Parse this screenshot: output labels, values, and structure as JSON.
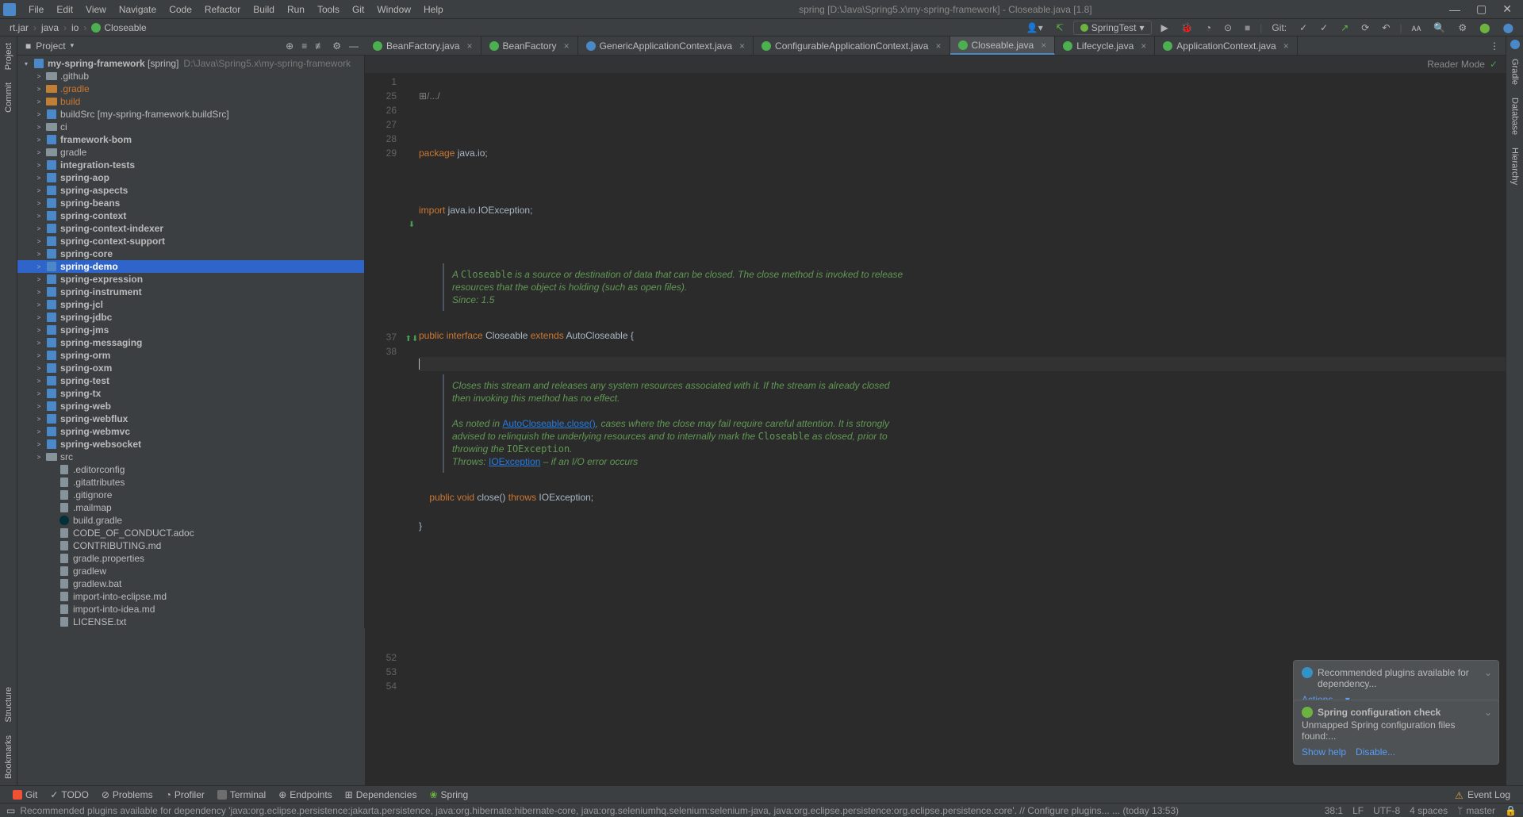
{
  "titlebar": {
    "menus": [
      "File",
      "Edit",
      "View",
      "Navigate",
      "Code",
      "Refactor",
      "Build",
      "Run",
      "Tools",
      "Git",
      "Window",
      "Help"
    ],
    "title": "spring [D:\\Java\\Spring5.x\\my-spring-framework] - Closeable.java [1.8]"
  },
  "navbar": {
    "crumbs": [
      "rt.jar",
      "java",
      "io",
      "Closeable"
    ],
    "run_config": "SpringTest",
    "git_label": "Git:"
  },
  "project_panel_label": "Project",
  "tree": {
    "root": {
      "label": "my-spring-framework",
      "suffix": "[spring]",
      "path": "D:\\Java\\Spring5.x\\my-spring-framework"
    },
    "items": [
      {
        "label": ".github",
        "indent": 1,
        "ico": "folder",
        "arrow": ">"
      },
      {
        "label": ".gradle",
        "indent": 1,
        "ico": "folder-orange",
        "arrow": ">",
        "color": "orange"
      },
      {
        "label": "build",
        "indent": 1,
        "ico": "folder-orange",
        "arrow": ">",
        "color": "orange"
      },
      {
        "label": "buildSrc",
        "indent": 1,
        "ico": "mod",
        "arrow": ">",
        "suffix": "[my-spring-framework.buildSrc]"
      },
      {
        "label": "ci",
        "indent": 1,
        "ico": "folder",
        "arrow": ">"
      },
      {
        "label": "framework-bom",
        "indent": 1,
        "ico": "mod",
        "arrow": ">",
        "bold": true
      },
      {
        "label": "gradle",
        "indent": 1,
        "ico": "folder",
        "arrow": ">"
      },
      {
        "label": "integration-tests",
        "indent": 1,
        "ico": "mod",
        "arrow": ">",
        "bold": true
      },
      {
        "label": "spring-aop",
        "indent": 1,
        "ico": "mod",
        "arrow": ">",
        "bold": true
      },
      {
        "label": "spring-aspects",
        "indent": 1,
        "ico": "mod",
        "arrow": ">",
        "bold": true
      },
      {
        "label": "spring-beans",
        "indent": 1,
        "ico": "mod",
        "arrow": ">",
        "bold": true
      },
      {
        "label": "spring-context",
        "indent": 1,
        "ico": "mod",
        "arrow": ">",
        "bold": true
      },
      {
        "label": "spring-context-indexer",
        "indent": 1,
        "ico": "mod",
        "arrow": ">",
        "bold": true
      },
      {
        "label": "spring-context-support",
        "indent": 1,
        "ico": "mod",
        "arrow": ">",
        "bold": true
      },
      {
        "label": "spring-core",
        "indent": 1,
        "ico": "mod",
        "arrow": ">",
        "bold": true
      },
      {
        "label": "spring-demo",
        "indent": 1,
        "ico": "mod",
        "arrow": ">",
        "bold": true,
        "selected": true
      },
      {
        "label": "spring-expression",
        "indent": 1,
        "ico": "mod",
        "arrow": ">",
        "bold": true
      },
      {
        "label": "spring-instrument",
        "indent": 1,
        "ico": "mod",
        "arrow": ">",
        "bold": true
      },
      {
        "label": "spring-jcl",
        "indent": 1,
        "ico": "mod",
        "arrow": ">",
        "bold": true
      },
      {
        "label": "spring-jdbc",
        "indent": 1,
        "ico": "mod",
        "arrow": ">",
        "bold": true
      },
      {
        "label": "spring-jms",
        "indent": 1,
        "ico": "mod",
        "arrow": ">",
        "bold": true
      },
      {
        "label": "spring-messaging",
        "indent": 1,
        "ico": "mod",
        "arrow": ">",
        "bold": true
      },
      {
        "label": "spring-orm",
        "indent": 1,
        "ico": "mod",
        "arrow": ">",
        "bold": true
      },
      {
        "label": "spring-oxm",
        "indent": 1,
        "ico": "mod",
        "arrow": ">",
        "bold": true
      },
      {
        "label": "spring-test",
        "indent": 1,
        "ico": "mod",
        "arrow": ">",
        "bold": true
      },
      {
        "label": "spring-tx",
        "indent": 1,
        "ico": "mod",
        "arrow": ">",
        "bold": true
      },
      {
        "label": "spring-web",
        "indent": 1,
        "ico": "mod",
        "arrow": ">",
        "bold": true
      },
      {
        "label": "spring-webflux",
        "indent": 1,
        "ico": "mod",
        "arrow": ">",
        "bold": true
      },
      {
        "label": "spring-webmvc",
        "indent": 1,
        "ico": "mod",
        "arrow": ">",
        "bold": true
      },
      {
        "label": "spring-websocket",
        "indent": 1,
        "ico": "mod",
        "arrow": ">",
        "bold": true
      },
      {
        "label": "src",
        "indent": 1,
        "ico": "folder",
        "arrow": ">"
      },
      {
        "label": ".editorconfig",
        "indent": 2,
        "ico": "file",
        "arrow": ""
      },
      {
        "label": ".gitattributes",
        "indent": 2,
        "ico": "file",
        "arrow": ""
      },
      {
        "label": ".gitignore",
        "indent": 2,
        "ico": "file",
        "arrow": ""
      },
      {
        "label": ".mailmap",
        "indent": 2,
        "ico": "file",
        "arrow": ""
      },
      {
        "label": "build.gradle",
        "indent": 2,
        "ico": "gradle",
        "arrow": ""
      },
      {
        "label": "CODE_OF_CONDUCT.adoc",
        "indent": 2,
        "ico": "file",
        "arrow": ""
      },
      {
        "label": "CONTRIBUTING.md",
        "indent": 2,
        "ico": "file",
        "arrow": ""
      },
      {
        "label": "gradle.properties",
        "indent": 2,
        "ico": "file",
        "arrow": ""
      },
      {
        "label": "gradlew",
        "indent": 2,
        "ico": "file",
        "arrow": ""
      },
      {
        "label": "gradlew.bat",
        "indent": 2,
        "ico": "file",
        "arrow": ""
      },
      {
        "label": "import-into-eclipse.md",
        "indent": 2,
        "ico": "file",
        "arrow": ""
      },
      {
        "label": "import-into-idea.md",
        "indent": 2,
        "ico": "file",
        "arrow": ""
      },
      {
        "label": "LICENSE.txt",
        "indent": 2,
        "ico": "file",
        "arrow": ""
      }
    ]
  },
  "editor": {
    "tabs": [
      {
        "label": "BeanFactory.java",
        "ico": "iface"
      },
      {
        "label": "BeanFactory",
        "ico": "iface"
      },
      {
        "label": "GenericApplicationContext.java",
        "ico": "class"
      },
      {
        "label": "ConfigurableApplicationContext.java",
        "ico": "iface"
      },
      {
        "label": "Closeable.java",
        "ico": "iface",
        "active": true
      },
      {
        "label": "Lifecycle.java",
        "ico": "iface"
      },
      {
        "label": "ApplicationContext.java",
        "ico": "iface"
      }
    ],
    "reader_mode": "Reader Mode",
    "line_numbers": [
      "1",
      "25",
      "26",
      "27",
      "28",
      "29",
      "",
      "",
      "",
      "",
      "37",
      "38",
      "",
      "",
      "",
      "",
      "",
      "",
      "52",
      "53",
      "54"
    ],
    "doc1_1": "A ",
    "doc1_mono": "Closeable",
    "doc1_2": " is a source or destination of data that can be closed. The close method is invoked to release resources that the object is holding (such as open files).",
    "doc1_since": "Since: 1.5",
    "doc2_1": "Closes this stream and releases any system resources associated with it. If the stream is already closed then invoking this method has no effect.",
    "doc2_2a": "As noted in ",
    "doc2_link1": "AutoCloseable.close()",
    "doc2_2b": ", cases where the close may fail require careful attention. It is strongly advised to relinquish the underlying resources and to internally ",
    "doc2_mark": "mark",
    "doc2_2c": " the ",
    "doc2_mono2": "Closeable",
    "doc2_2d": " as closed, prior to throwing the ",
    "doc2_mono3": "IOException",
    "doc2_2e": ".",
    "doc2_throws": "Throws: ",
    "doc2_link2": "IOException",
    "doc2_throws2": " – if an I/O error occurs",
    "code": {
      "l1": "/.../",
      "l26_kw": "package",
      "l26_rest": " java.io;",
      "l28_kw": "import",
      "l28_rest": " java.io.IOException;",
      "l37_pub": "public ",
      "l37_iface": "interface ",
      "l37_name": "Closeable ",
      "l37_ext": "extends ",
      "l37_parent": "AutoCloseable {",
      "l52_indent": "    ",
      "l52_pub": "public ",
      "l52_void": "void ",
      "l52_name": "close",
      "l52_paren": "() ",
      "l52_throws": "throws ",
      "l52_exc": "IOException",
      "l52_semi": ";",
      "l53": "}"
    }
  },
  "left_gutter": {
    "commit": "Commit",
    "project": "Project",
    "structure": "Structure",
    "bookmarks": "Bookmarks"
  },
  "right_gutter": {
    "gradle": "Gradle",
    "database": "Database",
    "hierarchy": "Hierarchy"
  },
  "notifs": {
    "n1_text": "Recommended plugins available for dependency...",
    "n1_action": "Actions",
    "n2_title": "Spring configuration check",
    "n2_text": "Unmapped Spring configuration files found:...",
    "n2_link1": "Show help",
    "n2_link2": "Disable..."
  },
  "status": {
    "git": "Git",
    "todo": "TODO",
    "problems": "Problems",
    "profiler": "Profiler",
    "terminal": "Terminal",
    "endpoints": "Endpoints",
    "dependencies": "Dependencies",
    "spring": "Spring",
    "event_log": "Event Log"
  },
  "msgbar": {
    "msg": "Recommended plugins available for dependency 'java:org.eclipse.persistence:jakarta.persistence, java:org.hibernate:hibernate-core, java:org.seleniumhq.selenium:selenium-java, java:org.eclipse.persistence:org.eclipse.persistence.core'. // Configure plugins... ... (today 13:53)",
    "pos": "38:1",
    "le": "LF",
    "enc": "UTF-8",
    "indent": "4 spaces",
    "branch": "master"
  }
}
